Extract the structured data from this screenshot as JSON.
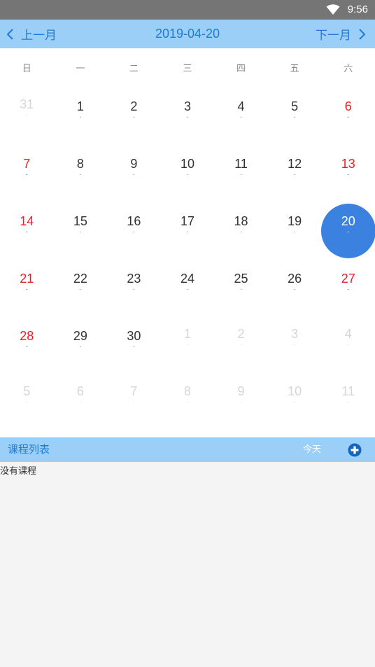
{
  "status": {
    "time": "9:56",
    "wifi_icon": "wifi-icon"
  },
  "header": {
    "prev_label": "上一月",
    "next_label": "下一月",
    "date": "2019-04-20"
  },
  "weekdays": [
    "日",
    "一",
    "二",
    "三",
    "四",
    "五",
    "六"
  ],
  "calendar": {
    "selected": "20",
    "weeks": [
      [
        {
          "d": "31",
          "dot": "-",
          "type": "other"
        },
        {
          "d": "1",
          "dot": "-"
        },
        {
          "d": "2",
          "dot": "-"
        },
        {
          "d": "3",
          "dot": "-"
        },
        {
          "d": "4",
          "dot": "-"
        },
        {
          "d": "5",
          "dot": "-"
        },
        {
          "d": "6",
          "dot": "-",
          "type": "weekend"
        }
      ],
      [
        {
          "d": "7",
          "dot": "-",
          "type": "weekend"
        },
        {
          "d": "8",
          "dot": "-"
        },
        {
          "d": "9",
          "dot": "-"
        },
        {
          "d": "10",
          "dot": "-"
        },
        {
          "d": "11",
          "dot": "-"
        },
        {
          "d": "12",
          "dot": "-"
        },
        {
          "d": "13",
          "dot": "-",
          "type": "weekend"
        }
      ],
      [
        {
          "d": "14",
          "dot": "-",
          "type": "weekend"
        },
        {
          "d": "15",
          "dot": "-"
        },
        {
          "d": "16",
          "dot": "-"
        },
        {
          "d": "17",
          "dot": "-"
        },
        {
          "d": "18",
          "dot": "-"
        },
        {
          "d": "19",
          "dot": "-"
        },
        {
          "d": "20",
          "dot": "-",
          "type": "selected"
        }
      ],
      [
        {
          "d": "21",
          "dot": "-",
          "type": "weekend"
        },
        {
          "d": "22",
          "dot": "-"
        },
        {
          "d": "23",
          "dot": "-"
        },
        {
          "d": "24",
          "dot": "-"
        },
        {
          "d": "25",
          "dot": "-"
        },
        {
          "d": "26",
          "dot": "-"
        },
        {
          "d": "27",
          "dot": "-",
          "type": "weekend"
        }
      ],
      [
        {
          "d": "28",
          "dot": "-",
          "type": "weekend"
        },
        {
          "d": "29",
          "dot": "-"
        },
        {
          "d": "30",
          "dot": "-"
        },
        {
          "d": "1",
          "dot": "-",
          "type": "other"
        },
        {
          "d": "2",
          "dot": "-",
          "type": "other"
        },
        {
          "d": "3",
          "dot": "-",
          "type": "other"
        },
        {
          "d": "4",
          "dot": "-",
          "type": "other"
        }
      ],
      [
        {
          "d": "5",
          "dot": "-",
          "type": "other"
        },
        {
          "d": "6",
          "dot": "-",
          "type": "other"
        },
        {
          "d": "7",
          "dot": "-",
          "type": "other"
        },
        {
          "d": "8",
          "dot": "-",
          "type": "other"
        },
        {
          "d": "9",
          "dot": "-",
          "type": "other"
        },
        {
          "d": "10",
          "dot": "-",
          "type": "other"
        },
        {
          "d": "11",
          "dot": "-",
          "type": "other"
        }
      ]
    ]
  },
  "course_list": {
    "title": "课程列表",
    "today_label": "今天",
    "add_icon": "add-circle-icon",
    "empty_text": "没有课程"
  },
  "colors": {
    "header_bg": "#9bcff7",
    "accent": "#1f7bd6",
    "selected": "#3b82e0",
    "weekend": "#e8202a",
    "status_bar": "#757575"
  }
}
